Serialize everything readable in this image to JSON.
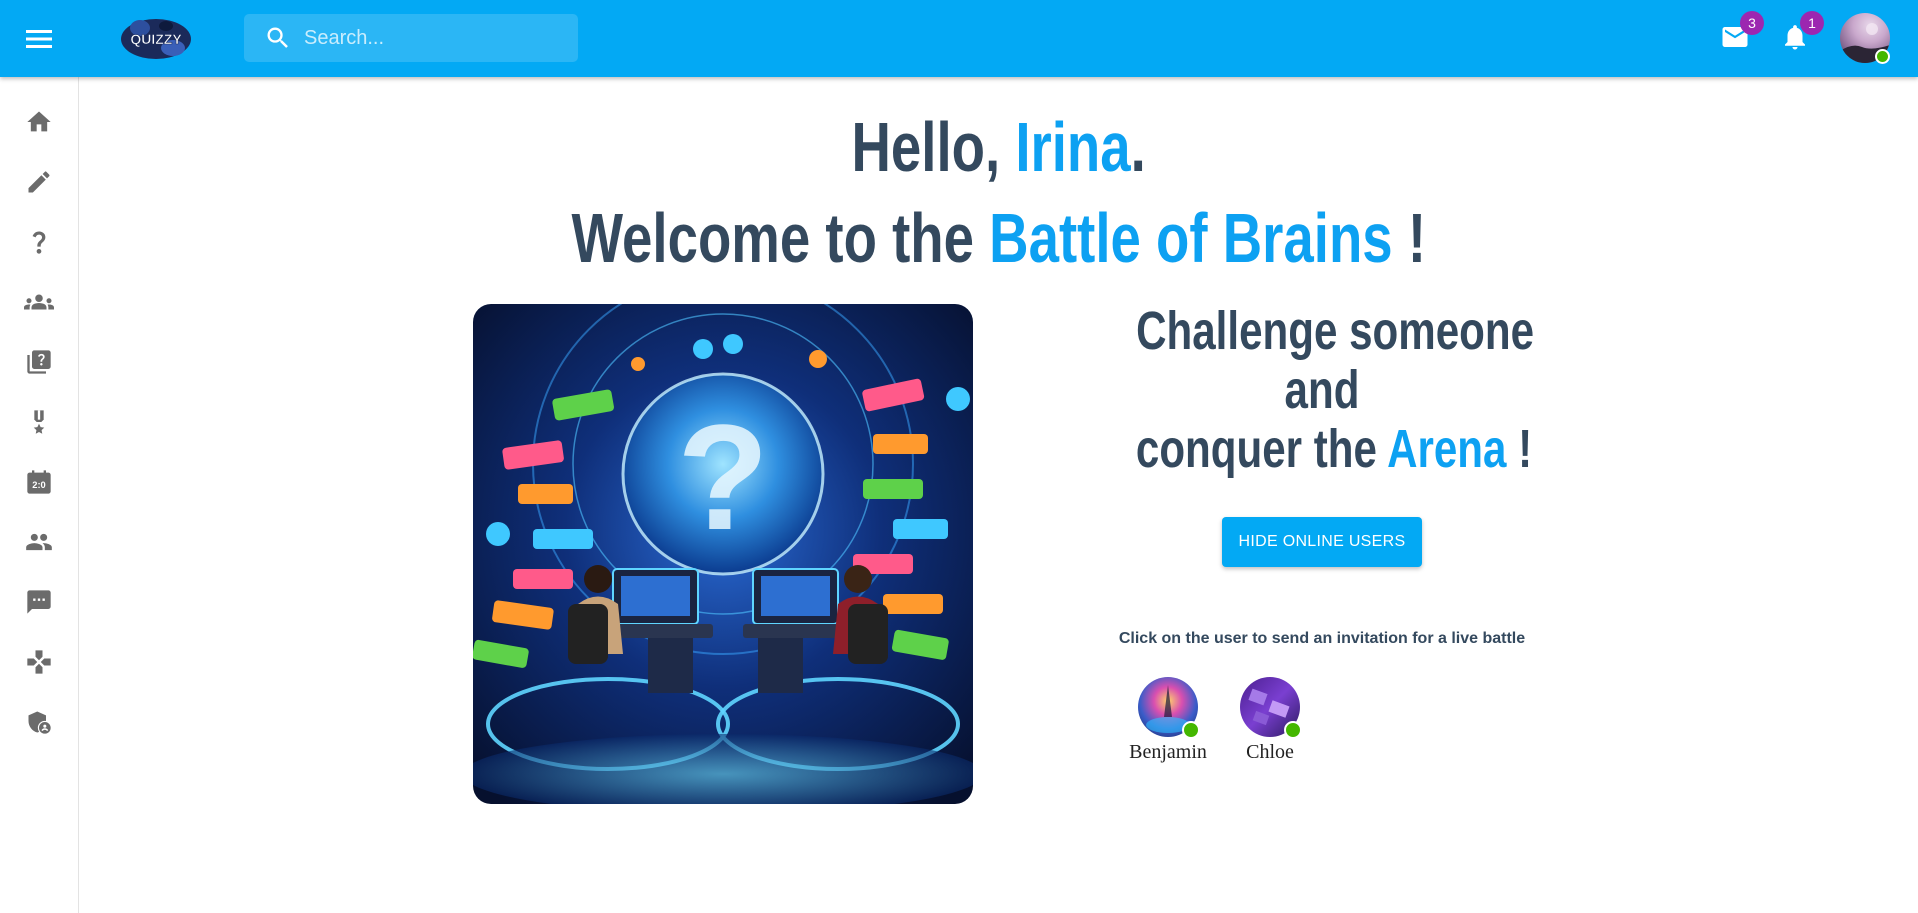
{
  "header": {
    "logo_text": "QUIZZY",
    "search_placeholder": "Search...",
    "mail_count": "3",
    "notification_count": "1"
  },
  "sidebar": {
    "items": [
      {
        "icon": "home-icon"
      },
      {
        "icon": "pencil-icon"
      },
      {
        "icon": "question-icon"
      },
      {
        "icon": "groups-icon"
      },
      {
        "icon": "quiz-library-icon"
      },
      {
        "icon": "medal-icon"
      },
      {
        "icon": "scoreboard-icon"
      },
      {
        "icon": "people-icon"
      },
      {
        "icon": "chat-icon"
      },
      {
        "icon": "gamepad-icon"
      },
      {
        "icon": "admin-shield-icon"
      }
    ]
  },
  "greeting": {
    "hello": "Hello,",
    "name": "Irina",
    "period": ".",
    "welcome": "Welcome to the",
    "battle": "Battle of Brains",
    "exclaim": "!"
  },
  "challenge": {
    "line1": "Challenge someone",
    "line2": "and",
    "line3": "conquer the",
    "arena": "Arena",
    "exclaim": "!"
  },
  "actions": {
    "hide_online_users": "HIDE ONLINE USERS"
  },
  "online_users": {
    "hint": "Click on the user to send an invitation for a live battle",
    "users": [
      {
        "name": "Benjamin"
      },
      {
        "name": "Chloe"
      }
    ]
  },
  "colors": {
    "primary": "#03a9f4",
    "heading": "#34495e",
    "highlight": "#0da1f2",
    "badge": "#9c27b0",
    "online": "#44b700"
  }
}
